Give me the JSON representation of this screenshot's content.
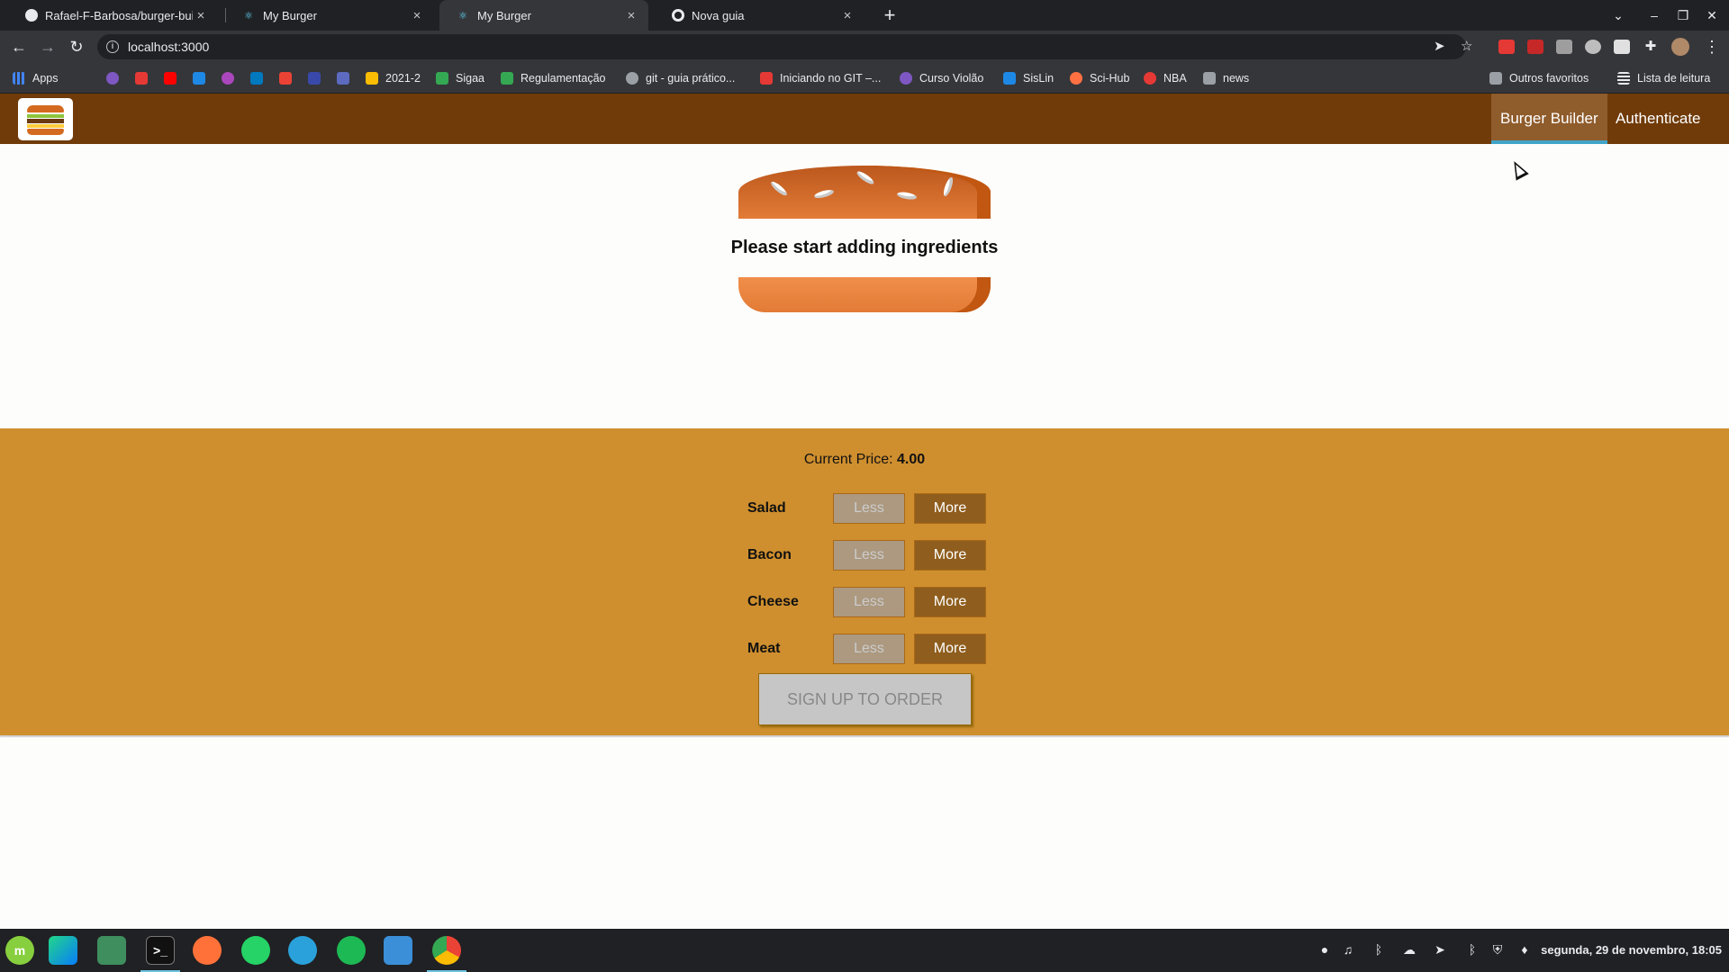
{
  "browser": {
    "tabs": [
      {
        "title": "Rafael-F-Barbosa/burger-buil",
        "active": false
      },
      {
        "title": "My Burger",
        "active": false
      },
      {
        "title": "My Burger",
        "active": true
      },
      {
        "title": "Nova guia",
        "active": false
      }
    ],
    "new_tab_label": "+",
    "url": "localhost:3000",
    "bookmarks": [
      {
        "label": "Apps",
        "color": "#4285f4"
      },
      {
        "label": "2021-2",
        "color": "#fbbc04"
      },
      {
        "label": "Sigaa",
        "color": "#34a853"
      },
      {
        "label": "Regulamentação",
        "color": "#34a853"
      },
      {
        "label": "git - guia prático...",
        "color": "#9aa0a6"
      },
      {
        "label": "Iniciando no GIT –...",
        "color": "#e53935"
      },
      {
        "label": "Curso Violão",
        "color": "#7e57c2"
      },
      {
        "label": "SisLin",
        "color": "#1e88e5"
      },
      {
        "label": "Sci-Hub",
        "color": "#ff7043"
      },
      {
        "label": "NBA",
        "color": "#e53935"
      },
      {
        "label": "news",
        "color": "#9aa0a6"
      }
    ],
    "other_bookmarks": "Outros favoritos",
    "reading_list": "Lista de leitura"
  },
  "app": {
    "nav": {
      "items": [
        {
          "label": "Burger Builder",
          "active": true
        },
        {
          "label": "Authenticate",
          "active": false
        }
      ]
    },
    "burger": {
      "empty_message": "Please start adding ingredients"
    },
    "controls": {
      "price_label": "Current Price: ",
      "price_value": "4.00",
      "less_label": "Less",
      "more_label": "More",
      "ingredients": [
        {
          "label": "Salad"
        },
        {
          "label": "Bacon"
        },
        {
          "label": "Cheese"
        },
        {
          "label": "Meat"
        }
      ],
      "order_button": "SIGN UP TO ORDER"
    }
  },
  "taskbar": {
    "clock": "segunda, 29 de novembro, 18:05"
  },
  "colors": {
    "toolbar": "#703b09",
    "controls_bg": "#cf8f2e",
    "more_btn": "#8f5e1e",
    "less_btn": "#ac9980",
    "active_nav_border": "#40a4c8"
  }
}
